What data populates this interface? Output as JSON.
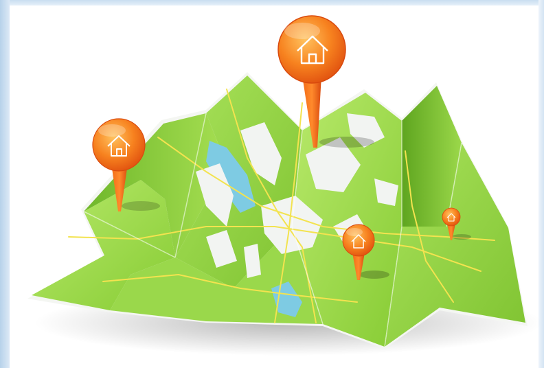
{
  "illustration": {
    "subject": "folded-map-with-location-pins",
    "icons": [
      "home-icon",
      "map-pin-icon"
    ],
    "colors": {
      "map_green": "#8fd13b",
      "map_green_light": "#b7e86a",
      "map_green_dark": "#5fa620",
      "water": "#7ecbe3",
      "urban": "#f2f4f2",
      "road": "#f3e34f",
      "pin_orange": "#f06a16",
      "pin_orange_light": "#ffb14d",
      "frame_blue": "#c9def0"
    },
    "pins": [
      {
        "name": "large-home-pin"
      },
      {
        "name": "left-home-pin"
      },
      {
        "name": "small-home-pin"
      },
      {
        "name": "tiny-pin"
      }
    ]
  }
}
